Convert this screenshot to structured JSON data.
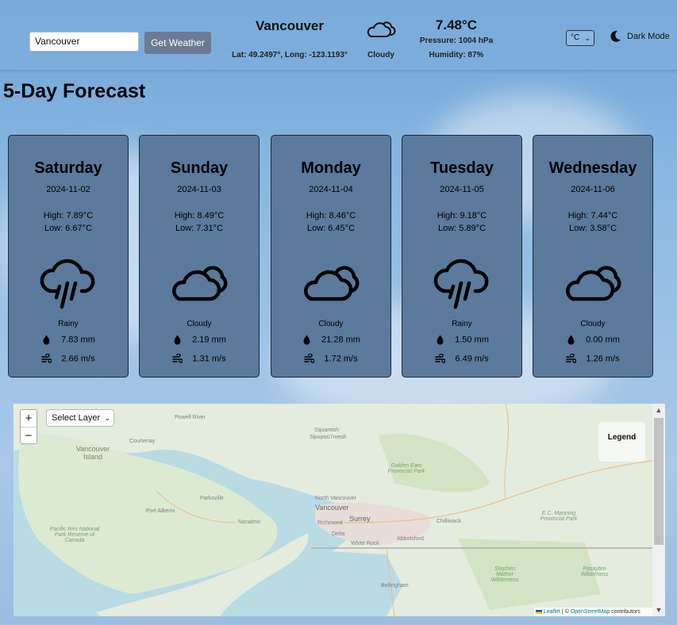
{
  "search": {
    "value": "Vancouver",
    "button": "Get Weather"
  },
  "current": {
    "city": "Vancouver",
    "coords": "Lat: 49.2497°, Long: -123.1193°",
    "condition": "Cloudy",
    "icon": "cloud-icon",
    "temp": "7.48°C",
    "pressure": "Pressure: 1004 hPa",
    "humidity": "Humidity: 87%"
  },
  "settings": {
    "unit": "°C",
    "dark_mode": "Dark Mode"
  },
  "forecast_title": "5-Day Forecast",
  "forecast": [
    {
      "day": "Saturday",
      "date": "2024-11-02",
      "high": "High: 7.89°C",
      "low": "Low: 6.67°C",
      "cond": "Rainy",
      "icon": "rain-icon",
      "precip": "7.83 mm",
      "wind": "2.66 m/s"
    },
    {
      "day": "Sunday",
      "date": "2024-11-03",
      "high": "High: 8.49°C",
      "low": "Low: 7.31°C",
      "cond": "Cloudy",
      "icon": "cloud-icon",
      "precip": "2.19 mm",
      "wind": "1.31 m/s"
    },
    {
      "day": "Monday",
      "date": "2024-11-04",
      "high": "High: 8.46°C",
      "low": "Low: 6.45°C",
      "cond": "Cloudy",
      "icon": "cloud-icon",
      "precip": "21.28 mm",
      "wind": "1.72 m/s"
    },
    {
      "day": "Tuesday",
      "date": "2024-11-05",
      "high": "High: 9.18°C",
      "low": "Low: 5.89°C",
      "cond": "Rainy",
      "icon": "rain-icon",
      "precip": "1.50 mm",
      "wind": "6.49 m/s"
    },
    {
      "day": "Wednesday",
      "date": "2024-11-06",
      "high": "High: 7.44°C",
      "low": "Low: 3.58°C",
      "cond": "Cloudy",
      "icon": "cloud-icon",
      "precip": "0.00 mm",
      "wind": "1.26 m/s"
    }
  ],
  "map": {
    "zoom_in": "+",
    "zoom_out": "−",
    "layer_select": "Select Layer",
    "legend": "Legend",
    "attribution": {
      "leaflet": "Leaflet",
      "sep": " | © ",
      "osm": "OpenStreetMap",
      "rest": " contributors"
    },
    "labels": {
      "powell_river": "Powell River",
      "courtenay": "Courtenay",
      "vancouver_island": "Vancouver Island",
      "squamish": "Squamish",
      "skwxwumesh": "Sḵwx̱wú7mesh",
      "golden_ears": "Golden Ears Provincial Park",
      "ec_manning": "E.C. Manning Provincial Park",
      "parksville": "Parksville",
      "port_alberni": "Port Alberni",
      "nanaimo": "Nanaimo",
      "north_vancouver": "North Vancouver",
      "vancouver": "Vancouver",
      "richmond": "Richmond",
      "surrey": "Surrey",
      "delta": "Delta",
      "white_rock": "White Rock",
      "abbotsford": "Abbotsford",
      "chilliwack": "Chilliwack",
      "pacific_rim": "Pacific Rim National Park Reserve of Canada",
      "stephen_mather": "Stephen Mather Wilderness",
      "pasayten": "Pasayten Wilderness",
      "bellingham": "Bellingham"
    }
  }
}
